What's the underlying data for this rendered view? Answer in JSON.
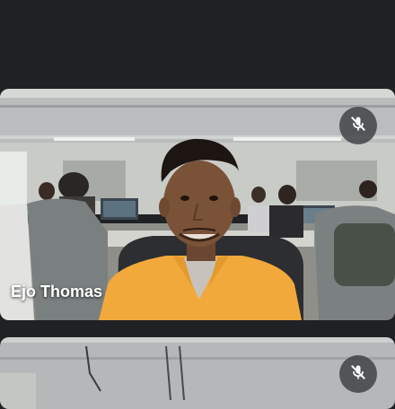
{
  "participants": [
    {
      "name": "Ejo Thomas",
      "mic_state": "muted",
      "mic_icon": "mic-off-icon"
    },
    {
      "name": "",
      "mic_state": "muted",
      "mic_icon": "mic-off-icon"
    }
  ],
  "colors": {
    "background": "#202124",
    "mic_button_bg": "#3c4043",
    "label_text": "#ffffff",
    "shirt": "#f2a93b"
  }
}
